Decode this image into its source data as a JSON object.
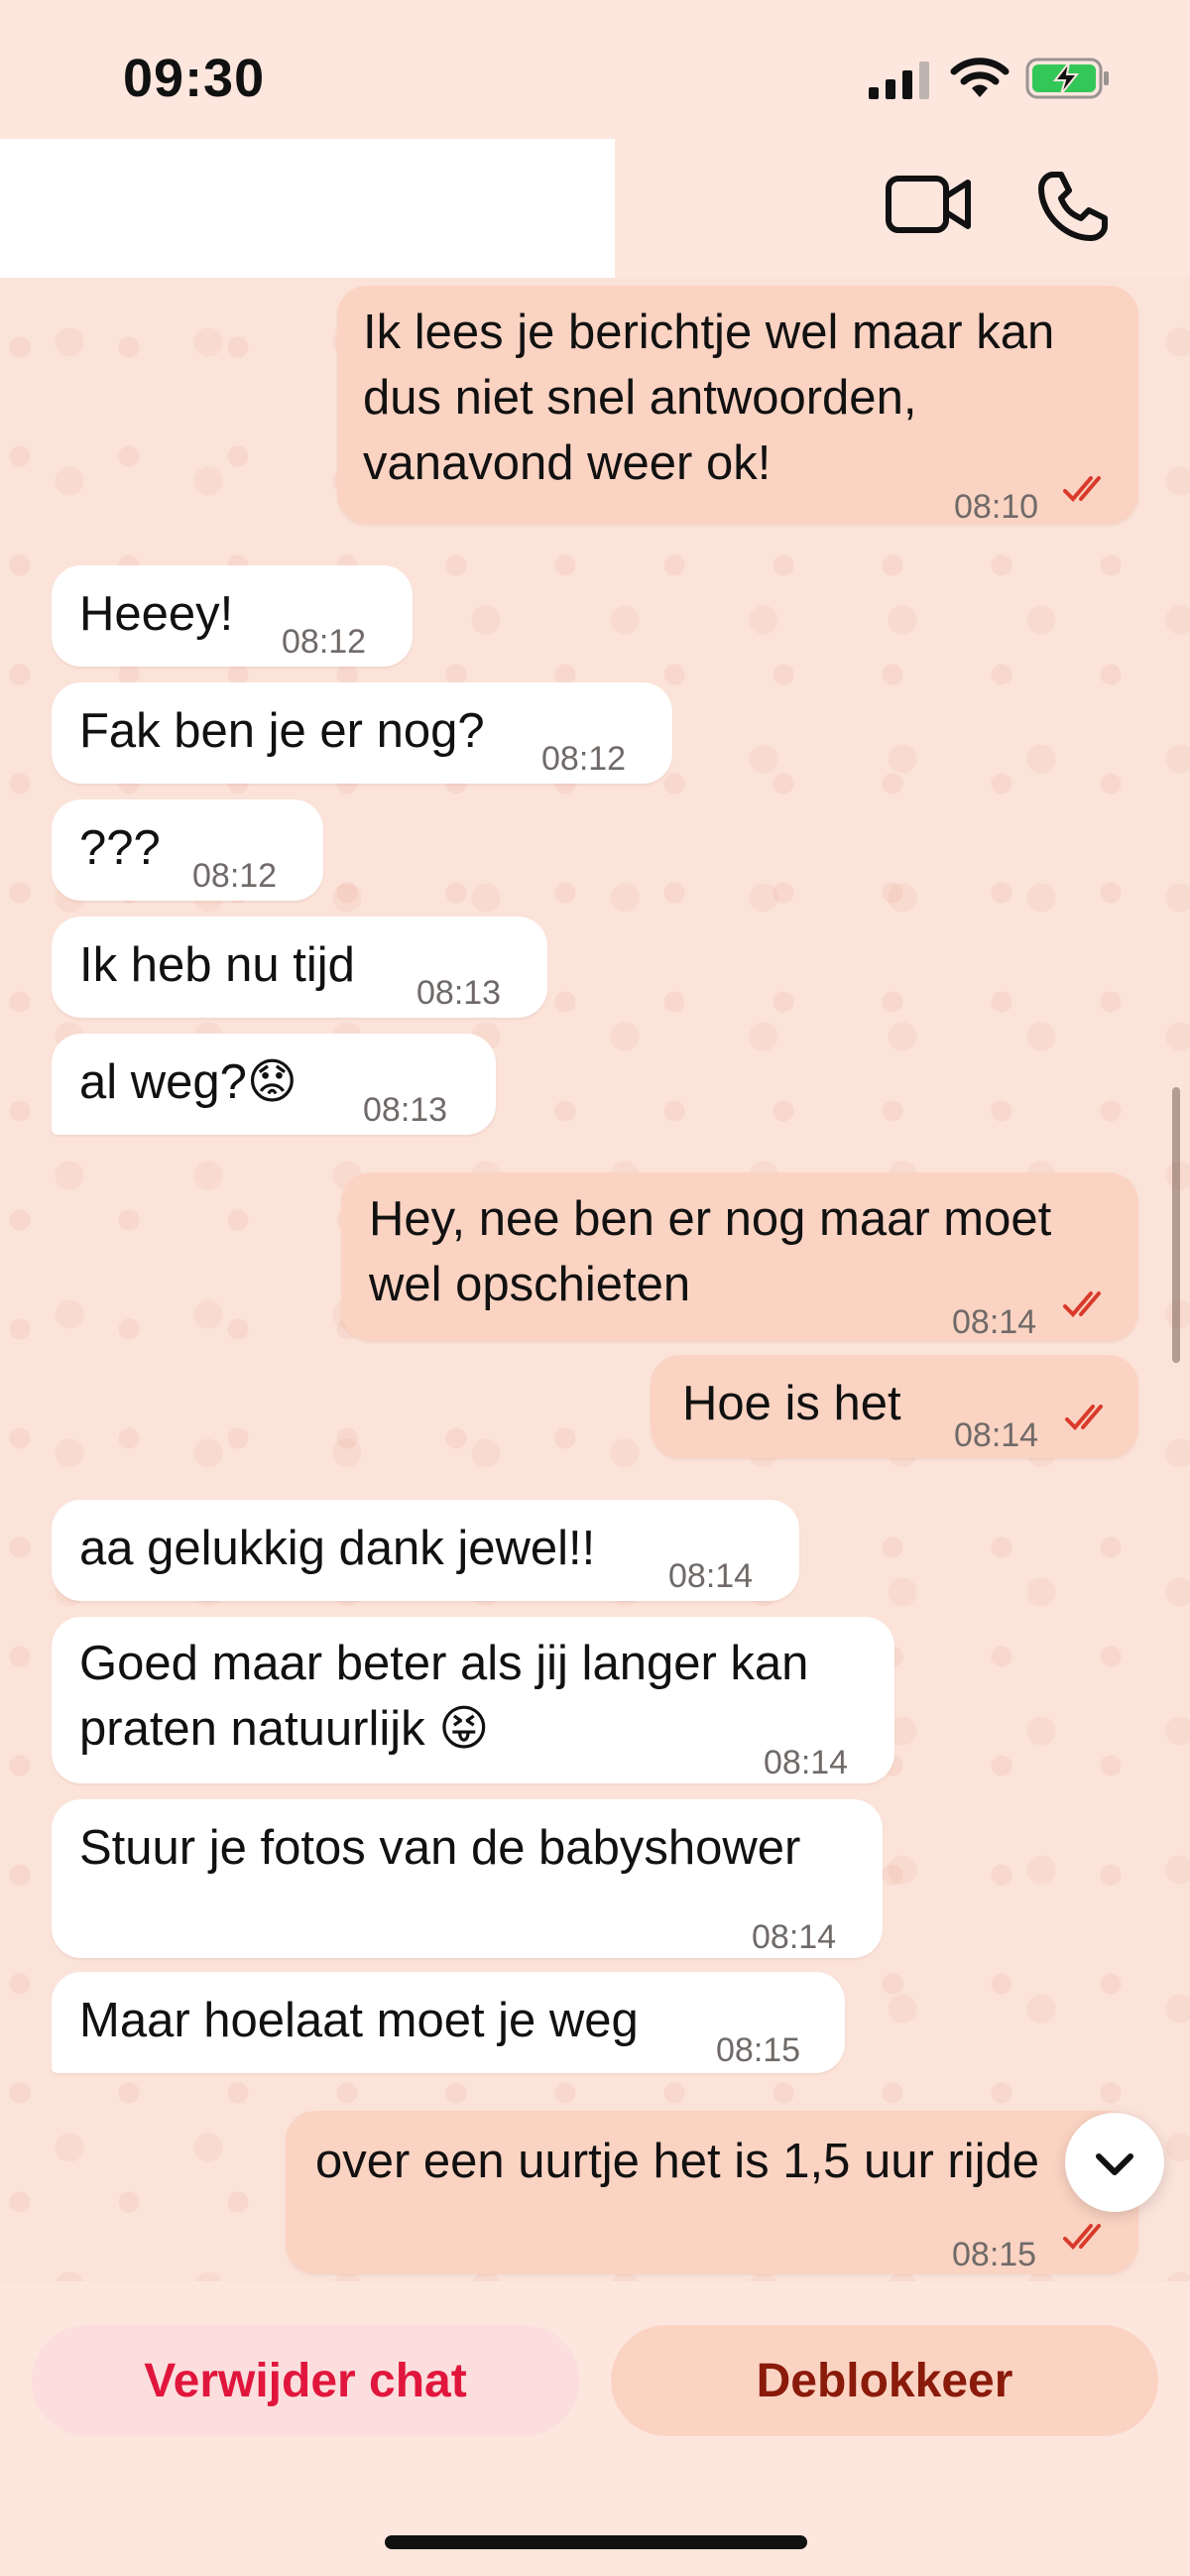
{
  "status_bar": {
    "time": "09:30"
  },
  "header": {
    "video_call": "video-icon",
    "voice_call": "phone-icon"
  },
  "messages": [
    {
      "dir": "out",
      "lines": [
        "Ik lees je berichtje wel maar kan",
        "dus niet snel antwoorden,",
        "vanavond weer ok!"
      ],
      "time": "08:10",
      "read": true
    },
    {
      "dir": "in",
      "lines": [
        "Heeey!"
      ],
      "time": "08:12"
    },
    {
      "dir": "in",
      "lines": [
        "Fak ben je er nog?"
      ],
      "time": "08:12"
    },
    {
      "dir": "in",
      "lines": [
        "???"
      ],
      "time": "08:12"
    },
    {
      "dir": "in",
      "lines": [
        "Ik heb nu tijd"
      ],
      "time": "08:13"
    },
    {
      "dir": "in",
      "lines": [
        "al weg?😟"
      ],
      "time": "08:13"
    },
    {
      "dir": "out",
      "lines": [
        "Hey, nee ben er nog maar moet",
        "wel opschieten"
      ],
      "time": "08:14",
      "read": true
    },
    {
      "dir": "out",
      "lines": [
        "Hoe is het"
      ],
      "time": "08:14",
      "read": true
    },
    {
      "dir": "in",
      "lines": [
        "aa gelukkig dank jewel!!"
      ],
      "time": "08:14"
    },
    {
      "dir": "in",
      "lines": [
        "Goed maar beter als jij langer kan",
        "praten natuurlijk 😝"
      ],
      "time": "08:14"
    },
    {
      "dir": "in",
      "lines": [
        "Stuur je fotos van de babyshower"
      ],
      "time": "08:14"
    },
    {
      "dir": "in",
      "lines": [
        "Maar hoelaat moet je weg"
      ],
      "time": "08:15"
    },
    {
      "dir": "out",
      "lines": [
        "over een uurtje het is 1,5 uur rijde"
      ],
      "time": "08:15",
      "read": true
    }
  ],
  "actions": {
    "delete_chat": "Verwijder chat",
    "unblock": "Deblokkeer"
  },
  "colors": {
    "incoming": "#ffffff",
    "outgoing": "#fbd3c2",
    "read_ticks": "#d93a2b",
    "delete": "#e1163d",
    "unblock": "#8a1a0a"
  }
}
